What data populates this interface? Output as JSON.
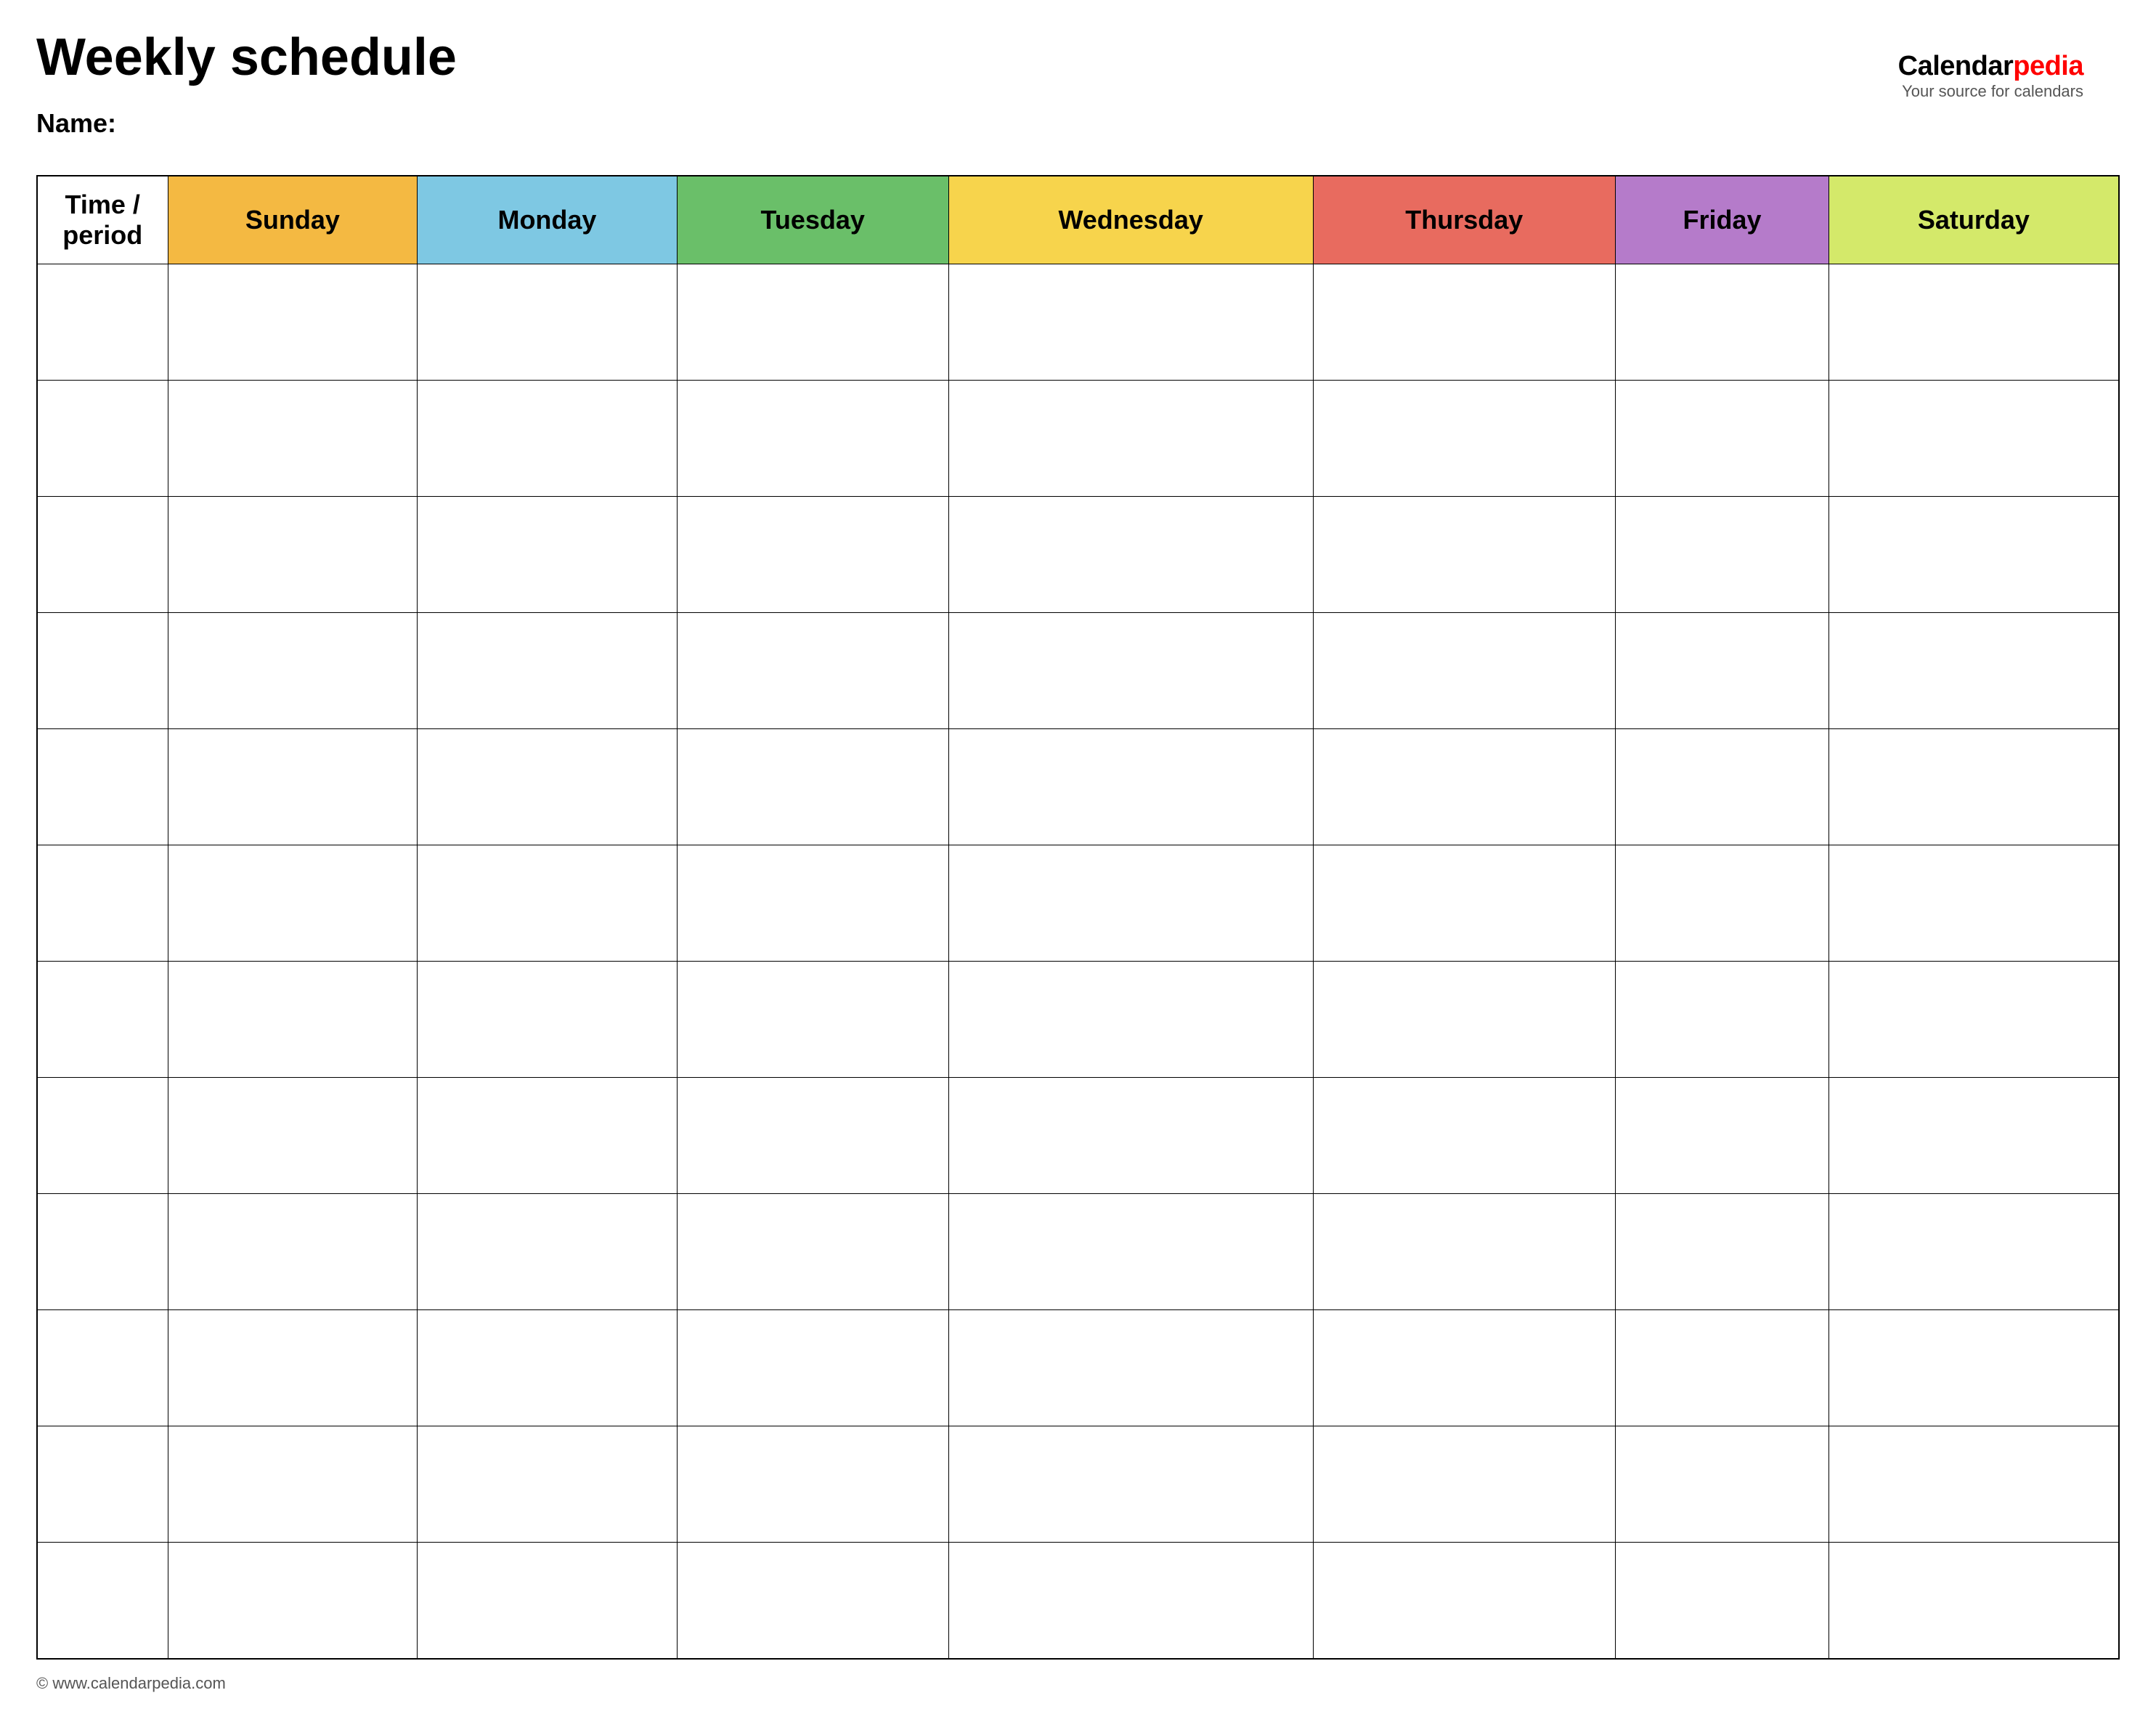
{
  "page": {
    "title": "Weekly schedule",
    "name_label": "Name:",
    "footer_url": "© www.calendarpedia.com"
  },
  "brand": {
    "name_black": "Calendar",
    "name_red": "pedia",
    "tagline": "Your source for calendars"
  },
  "table": {
    "headers": [
      {
        "key": "time",
        "label": "Time / period",
        "color": "header-time"
      },
      {
        "key": "sunday",
        "label": "Sunday",
        "color": "header-sunday"
      },
      {
        "key": "monday",
        "label": "Monday",
        "color": "header-monday"
      },
      {
        "key": "tuesday",
        "label": "Tuesday",
        "color": "header-tuesday"
      },
      {
        "key": "wednesday",
        "label": "Wednesday",
        "color": "header-wednesday"
      },
      {
        "key": "thursday",
        "label": "Thursday",
        "color": "header-thursday"
      },
      {
        "key": "friday",
        "label": "Friday",
        "color": "header-friday"
      },
      {
        "key": "saturday",
        "label": "Saturday",
        "color": "header-saturday"
      }
    ],
    "row_count": 12
  }
}
